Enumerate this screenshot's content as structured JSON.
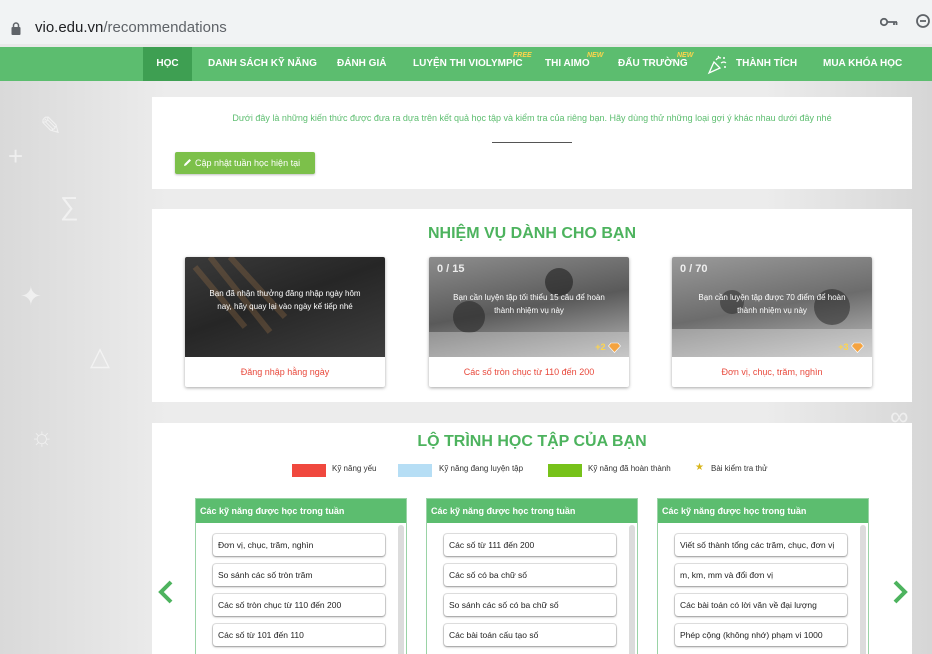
{
  "browser": {
    "url_host": "vio.edu.vn",
    "url_path": "/recommendations"
  },
  "nav": {
    "items": [
      {
        "label": "HỌC"
      },
      {
        "label": "DANH SÁCH KỸ NĂNG"
      },
      {
        "label": "ĐÁNH GIÁ"
      },
      {
        "label": "LUYỆN THI VIOLYMPIC",
        "badge": "FREE"
      },
      {
        "label": "THI AIMO",
        "badge": "NEW"
      },
      {
        "label": "ĐẤU TRƯỜNG",
        "badge": "NEW"
      },
      {
        "label": "THÀNH TÍCH"
      },
      {
        "label": "MUA KHÓA HỌC"
      }
    ]
  },
  "intro": {
    "text": "Dưới đây là những kiến thức được đưa ra dựa trên kết quả học tập và kiểm tra của riêng bạn. Hãy dùng thử những loại gợi ý khác nhau dưới đây nhé",
    "update_button": "Cập nhật tuần học hiện tại"
  },
  "missions": {
    "title": "NHIỆM VỤ DÀNH CHO BẠN",
    "cards": [
      {
        "progress": "",
        "overlay": "Bạn đã nhận thưởng đăng nhập ngày hôm nay, hãy quay lại vào ngày kế tiếp nhé",
        "reward": "",
        "label": "Đăng nhập hằng ngày"
      },
      {
        "progress": "0 / 15",
        "overlay": "Bạn cần luyện tập tối thiểu 15 câu để hoàn thành nhiệm vụ này",
        "reward": "+2",
        "label": "Các số tròn chục từ 110 đến 200"
      },
      {
        "progress": "0 / 70",
        "overlay": "Bạn cần luyện tập được 70 điểm để hoàn thành nhiệm vụ này",
        "reward": "+3",
        "label": "Đơn vị, chục, trăm, nghìn"
      }
    ]
  },
  "path": {
    "title": "LỘ TRÌNH HỌC TẬP CỦA BẠN",
    "legend": [
      {
        "label": "Kỹ năng yếu",
        "color": "#f0483e"
      },
      {
        "label": "Kỹ năng đang luyện tập",
        "color": "#b6def5"
      },
      {
        "label": "Kỹ năng đã hoàn thành",
        "color": "#77c21a"
      },
      {
        "label": "Bài kiểm tra thử",
        "icon": "star-icon"
      }
    ],
    "columns": [
      {
        "header": "Các kỹ năng được học trong tuần",
        "skills": [
          "Đơn vị, chục, trăm, nghìn",
          "So sánh các số tròn trăm",
          "Các số tròn chục từ 110 đến 200",
          "Các số từ 101 đến 110"
        ]
      },
      {
        "header": "Các kỹ năng được học trong tuần",
        "skills": [
          "Các số từ 111 đến 200",
          "Các số có ba chữ số",
          "So sánh các số có ba chữ số",
          "Các bài toán cấu tạo số"
        ]
      },
      {
        "header": "Các kỹ năng được học trong tuần",
        "skills": [
          "Viết số thành tổng các trăm, chục, đơn vị",
          "m, km, mm và đổi đơn vị",
          "Các bài toán có lời văn về đại lượng",
          "Phép cộng (không nhớ) phạm vi 1000"
        ]
      }
    ]
  },
  "colors": {
    "brand_green": "#5cbd6f",
    "active_nav": "#3e9f52",
    "title_green": "#4db35e",
    "red_label": "#e8493c"
  }
}
